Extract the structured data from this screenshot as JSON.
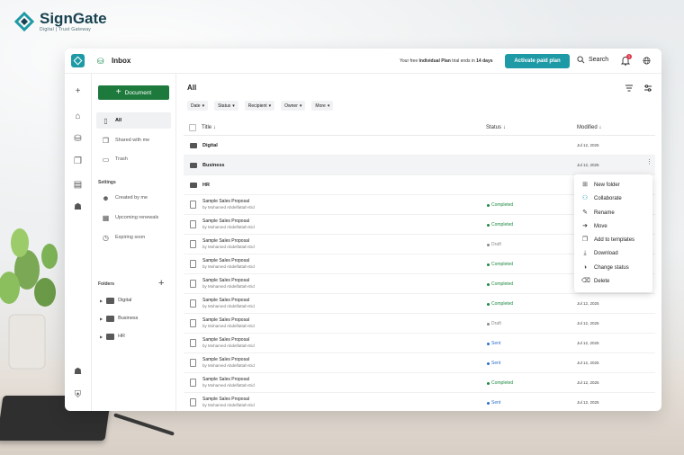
{
  "brand": {
    "name": "SignGate",
    "tagline": "Digital | Trust Gateway"
  },
  "topbar": {
    "title": "Inbox",
    "trial_prefix": "Your free ",
    "trial_plan": "Individual Plan",
    "trial_middle": " trial ends in ",
    "trial_days": "14 days",
    "activate_label": "Activate paid plan",
    "search_label": "Search",
    "notification_count": "1"
  },
  "sidebar": {
    "new_document_label": "Document",
    "nav": [
      {
        "label": "All",
        "icon": "document-icon"
      },
      {
        "label": "Shared with me",
        "icon": "shared-icon"
      },
      {
        "label": "Trash",
        "icon": "trash-icon"
      }
    ],
    "settings_label": "Settings",
    "settings_items": [
      {
        "label": "Created by me",
        "icon": "user-icon"
      },
      {
        "label": "Upcoming renewals",
        "icon": "calendar-icon"
      },
      {
        "label": "Expiring soon",
        "icon": "clock-icon"
      }
    ],
    "folders_label": "Folders",
    "folders": [
      {
        "label": "Digital"
      },
      {
        "label": "Business"
      },
      {
        "label": "HR"
      }
    ]
  },
  "main": {
    "title": "All",
    "filters": [
      "Date",
      "Status",
      "Recipient",
      "Owner",
      "More"
    ],
    "columns": {
      "title": "Title",
      "status": "Status",
      "modified": "Modified"
    },
    "folder_rows": [
      {
        "name": "Digital",
        "modified": "Jul 12, 2025"
      },
      {
        "name": "Business",
        "modified": "Jul 12, 2025"
      },
      {
        "name": "HR",
        "modified": ""
      }
    ],
    "doc_rows": [
      {
        "name": "Sample Sales Proposal",
        "by": "by Mohamed Abdelfattah-Eid",
        "status": "Completed",
        "modified": ""
      },
      {
        "name": "Sample Sales Proposal",
        "by": "by Mohamed Abdelfattah-Eid",
        "status": "Completed",
        "modified": ""
      },
      {
        "name": "Sample Sales Proposal",
        "by": "by Mohamed Abdelfattah-Eid",
        "status": "Draft",
        "modified": ""
      },
      {
        "name": "Sample Sales Proposal",
        "by": "by Mohamed Abdelfattah-Eid",
        "status": "Completed",
        "modified": ""
      },
      {
        "name": "Sample Sales Proposal",
        "by": "by Mohamed Abdelfattah-Eid",
        "status": "Completed",
        "modified": ""
      },
      {
        "name": "Sample Sales Proposal",
        "by": "by Mohamed Abdelfattah-Eid",
        "status": "Completed",
        "modified": "Jul 12, 2025"
      },
      {
        "name": "Sample Sales Proposal",
        "by": "by Mohamed Abdelfattah-Eid",
        "status": "Draft",
        "modified": "Jul 12, 2025"
      },
      {
        "name": "Sample Sales Proposal",
        "by": "by Mohamed Abdelfattah-Eid",
        "status": "Sent",
        "modified": "Jul 12, 2025"
      },
      {
        "name": "Sample Sales Proposal",
        "by": "by Mohamed Abdelfattah-Eid",
        "status": "Sent",
        "modified": "Jul 12, 2025"
      },
      {
        "name": "Sample Sales Proposal",
        "by": "by Mohamed Abdelfattah-Eid",
        "status": "Completed",
        "modified": "Jul 12, 2025"
      },
      {
        "name": "Sample Sales Proposal",
        "by": "by Mohamed Abdelfattah-Eid",
        "status": "Sent",
        "modified": "Jul 12, 2025"
      }
    ]
  },
  "context_menu": [
    {
      "label": "New folder",
      "icon": "folder-plus-icon"
    },
    {
      "label": "Collaborate",
      "icon": "people-icon"
    },
    {
      "label": "Rename",
      "icon": "rename-icon"
    },
    {
      "label": "Move",
      "icon": "move-icon"
    },
    {
      "label": "Add to templates",
      "icon": "template-icon"
    },
    {
      "label": "Download",
      "icon": "download-icon"
    },
    {
      "label": "Change status",
      "icon": "status-icon"
    },
    {
      "label": "Delete",
      "icon": "trash-icon"
    }
  ],
  "colors": {
    "accent": "#1e9aa6",
    "primary_button": "#1e7a3c",
    "completed": "#1e8a45",
    "draft": "#888888",
    "sent": "#2a6fc9"
  }
}
